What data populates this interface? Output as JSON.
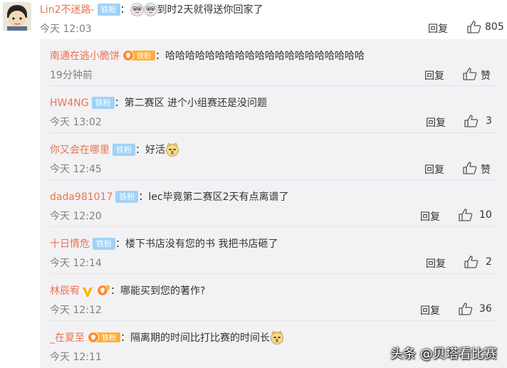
{
  "top_comment": {
    "username": "Lin2不迷路-",
    "badge": "铁粉",
    "text": "到时2天就得送你回家了",
    "time": "今天 12:03",
    "reply_label": "回复",
    "like_count": "805"
  },
  "replies": [
    {
      "username": "南通在逃小脆饼",
      "badge": "铁粉",
      "text": "哈哈哈哈哈哈哈哈哈哈哈哈哈哈哈哈哈哈哈哈",
      "time": "19分钟前",
      "reply_label": "回复",
      "like": "赞"
    },
    {
      "username": "HW4NG",
      "badge": "铁粉",
      "text": "第二赛区  进个小组赛还是没问题",
      "time": "今天 13:02",
      "reply_label": "回复",
      "like": "3"
    },
    {
      "username": "你又会在哪里",
      "badge": "铁粉",
      "text": "好活",
      "time": "今天 12:45",
      "reply_label": "回复",
      "like": "赞"
    },
    {
      "username": "dada981017",
      "badge": "铁粉",
      "text": "lec毕竟第二赛区2天有点离谱了",
      "time": "今天 12:20",
      "reply_label": "回复",
      "like": "10"
    },
    {
      "username": "十日情危",
      "badge": "铁粉",
      "text": "楼下书店没有您的书 我把书店砸了",
      "time": "今天 12:14",
      "reply_label": "回复",
      "like": "2"
    },
    {
      "username": "林辰宥",
      "badge": "",
      "text": "哪能买到您的著作?",
      "time": "今天 12:12",
      "reply_label": "回复",
      "like": "36"
    },
    {
      "username": "_在夏至",
      "badge": "铁粉",
      "text": "隔离期的时间比打比赛的时间长",
      "time": "今天 12:11",
      "reply_label": "",
      "like": ""
    }
  ],
  "watermark": "头条 @贝塔看比赛",
  "colors": {
    "username": "#eb7350",
    "badge": "#9fd2f7",
    "reply_bg": "#f2f2f5"
  }
}
